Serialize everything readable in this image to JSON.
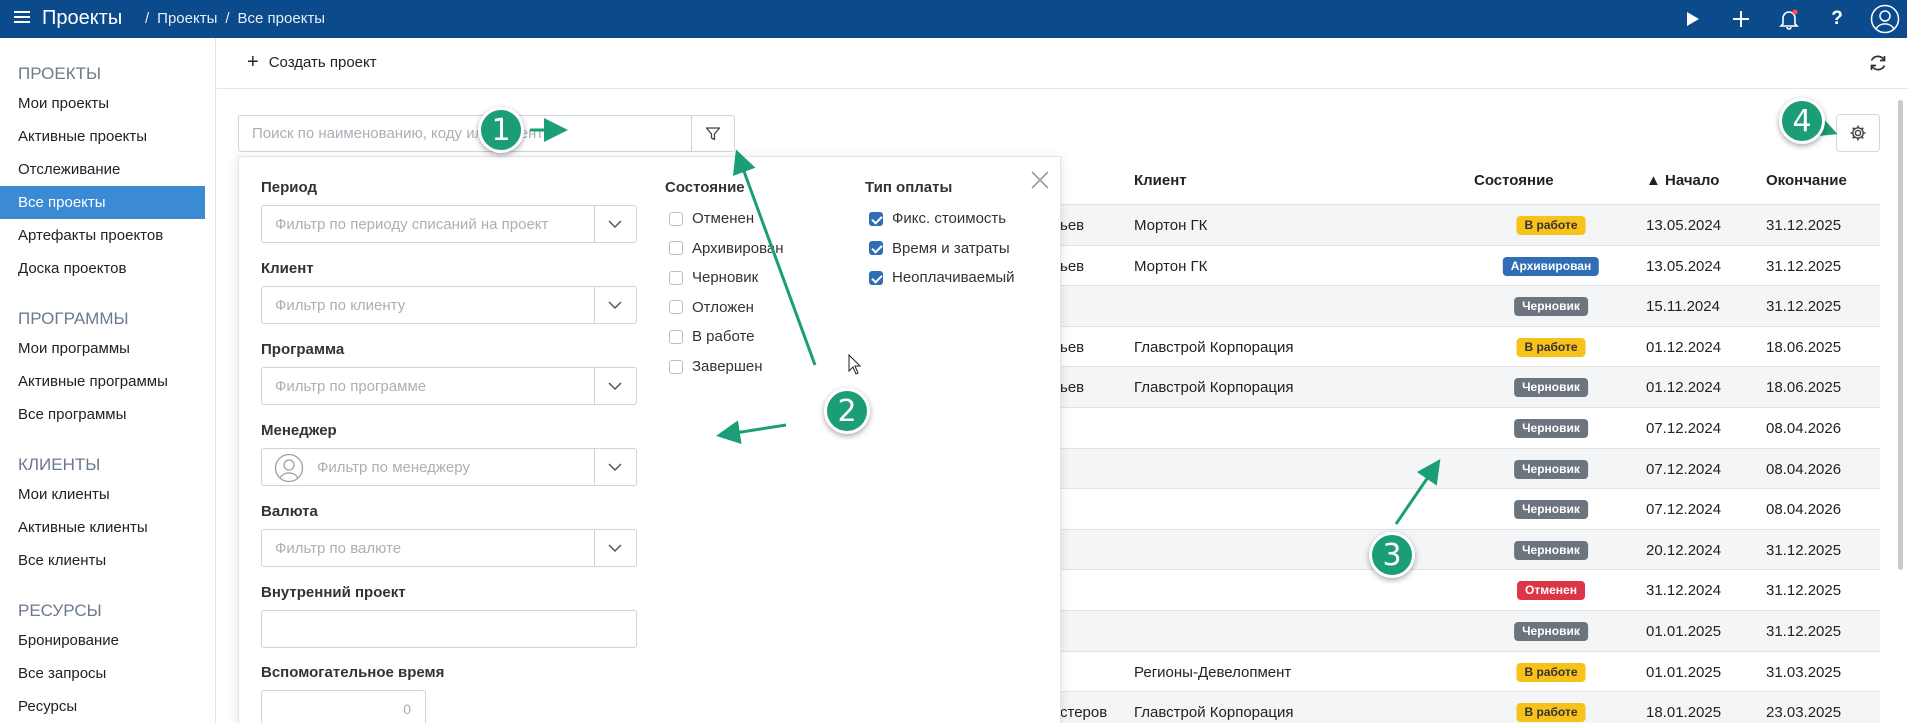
{
  "topbar": {
    "app_title": "Проекты",
    "breadcrumbs": [
      "/",
      "Проекты",
      "/",
      "Все проекты"
    ],
    "icons": [
      "play-icon",
      "plus-icon",
      "bell-icon",
      "help-icon",
      "user-icon"
    ],
    "help_label": "?",
    "accent_color": "#0b4a8b"
  },
  "sidebar": {
    "sections": [
      {
        "title": "ПРОЕКТЫ",
        "items": [
          "Мои проекты",
          "Активные проекты",
          "Отслеживание",
          "Все проекты",
          "Артефакты проектов",
          "Доска проектов"
        ]
      },
      {
        "title": "ПРОГРАММЫ",
        "items": [
          "Мои программы",
          "Активные программы",
          "Все программы"
        ]
      },
      {
        "title": "КЛИЕНТЫ",
        "items": [
          "Мои клиенты",
          "Активные клиенты",
          "Все клиенты"
        ]
      },
      {
        "title": "РЕСУРСЫ",
        "items": [
          "Бронирование",
          "Все запросы",
          "Ресурсы"
        ]
      }
    ],
    "active_item": "Все проекты"
  },
  "toolbar": {
    "create_label": "Создать проект"
  },
  "search": {
    "placeholder": "Поиск по наименованию, коду или клиенту"
  },
  "table": {
    "headers": {
      "client": "Клиент",
      "state": "Состояние",
      "start": "▲ Начало",
      "end": "Окончание"
    },
    "rows": [
      {
        "owner": "ьев",
        "client": "Мортон ГК",
        "state": "В работе",
        "kind": "work",
        "start": "13.05.2024",
        "end": "31.12.2025"
      },
      {
        "owner": "ьев",
        "client": "Мортон ГК",
        "state": "Архивирован",
        "kind": "arch",
        "start": "13.05.2024",
        "end": "31.12.2025"
      },
      {
        "owner": "",
        "client": "",
        "state": "Черновик",
        "kind": "draft",
        "start": "15.11.2024",
        "end": "31.12.2025"
      },
      {
        "owner": "ьев",
        "client": "Главстрой Корпорация",
        "state": "В работе",
        "kind": "work",
        "start": "01.12.2024",
        "end": "18.06.2025"
      },
      {
        "owner": "ьев",
        "client": "Главстрой Корпорация",
        "state": "Черновик",
        "kind": "draft",
        "start": "01.12.2024",
        "end": "18.06.2025"
      },
      {
        "owner": "",
        "client": "",
        "state": "Черновик",
        "kind": "draft",
        "start": "07.12.2024",
        "end": "08.04.2026"
      },
      {
        "owner": "",
        "client": "",
        "state": "Черновик",
        "kind": "draft",
        "start": "07.12.2024",
        "end": "08.04.2026"
      },
      {
        "owner": "",
        "client": "",
        "state": "Черновик",
        "kind": "draft",
        "start": "07.12.2024",
        "end": "08.04.2026"
      },
      {
        "owner": "",
        "client": "",
        "state": "Черновик",
        "kind": "draft",
        "start": "20.12.2024",
        "end": "31.12.2025"
      },
      {
        "owner": "",
        "client": "",
        "state": "Отменен",
        "kind": "cancel",
        "start": "31.12.2024",
        "end": "31.12.2025"
      },
      {
        "owner": "",
        "client": "",
        "state": "Черновик",
        "kind": "draft",
        "start": "01.01.2025",
        "end": "31.12.2025"
      },
      {
        "owner": "",
        "client": "Регионы-Девелопмент",
        "state": "В работе",
        "kind": "work",
        "start": "01.01.2025",
        "end": "31.03.2025"
      },
      {
        "owner": "стеров",
        "client": "Главстрой Корпорация",
        "state": "В работе",
        "kind": "work",
        "start": "18.01.2025",
        "end": "23.03.2025"
      }
    ],
    "status_colors": {
      "work": "#f7c21a",
      "arch": "#2f6db5",
      "draft": "#6c757d",
      "cancel": "#dc3545"
    }
  },
  "filter_panel": {
    "fields": {
      "period": {
        "label": "Период",
        "placeholder": "Фильтр по периоду списаний на проект"
      },
      "client": {
        "label": "Клиент",
        "placeholder": "Фильтр по клиенту"
      },
      "program": {
        "label": "Программа",
        "placeholder": "Фильтр по программе"
      },
      "manager": {
        "label": "Менеджер",
        "placeholder": "Фильтр по менеджеру"
      },
      "currency": {
        "label": "Валюта",
        "placeholder": "Фильтр по валюте"
      },
      "internal": {
        "label": "Внутренний проект",
        "value": ""
      },
      "aux_time": {
        "label": "Вспомогательное время",
        "value": "0"
      }
    },
    "state_group": {
      "title": "Состояние",
      "options": [
        {
          "label": "Отменен",
          "checked": false
        },
        {
          "label": "Архивирован",
          "checked": false
        },
        {
          "label": "Черновик",
          "checked": false
        },
        {
          "label": "Отложен",
          "checked": false
        },
        {
          "label": "В работе",
          "checked": false
        },
        {
          "label": "Завершен",
          "checked": false
        }
      ]
    },
    "payment_group": {
      "title": "Тип оплаты",
      "options": [
        {
          "label": "Фикс. стоимость",
          "checked": true
        },
        {
          "label": "Время и затраты",
          "checked": true
        },
        {
          "label": "Неоплачиваемый",
          "checked": true
        }
      ]
    }
  },
  "annotations": {
    "markers": [
      "1",
      "2",
      "3",
      "4"
    ],
    "color": "#1b9e77"
  }
}
